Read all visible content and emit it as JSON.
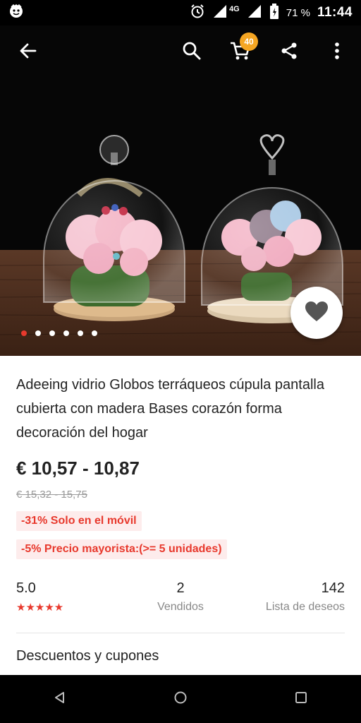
{
  "status_bar": {
    "time": "11:44",
    "battery_percent": "71 %",
    "network": "4G",
    "icons": [
      "app-logo-icon",
      "alarm-icon",
      "signal-icon",
      "battery-icon"
    ]
  },
  "toolbar": {
    "cart_count": "40",
    "icons": [
      "back-arrow-icon",
      "search-icon",
      "cart-icon",
      "share-icon",
      "more-vert-icon"
    ]
  },
  "gallery": {
    "image_count": 6,
    "active_index": 0
  },
  "product": {
    "title": "Adeeing vidrio Globos terráqueos cúpula pantalla cubierta con madera Bases corazón forma decoración del hogar",
    "price": "€ 10,57 - 10,87",
    "old_price": "€ 15,32 - 15,75",
    "discount_tag": "-31%  Solo en el móvil",
    "wholesale_tag": "-5%  Precio mayorista:(>= 5 unidades)"
  },
  "stats": {
    "rating": "5.0",
    "rating_stars": "★★★★★",
    "sold_count": "2",
    "sold_label": "Vendidos",
    "wishlist_count": "142",
    "wishlist_label": "Lista de deseos"
  },
  "sections": {
    "discounts_title": "Descuentos y cupones"
  },
  "colors": {
    "accent_red": "#e8392d",
    "badge_orange": "#f5a623",
    "tag_bg": "#fdecec"
  }
}
